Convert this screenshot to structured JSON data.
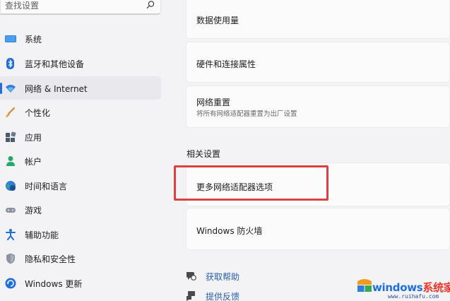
{
  "search": {
    "placeholder": "查找设置"
  },
  "sidebar": {
    "items": [
      {
        "label": "系统",
        "icon": "monitor-icon"
      },
      {
        "label": "蓝牙和其他设备",
        "icon": "bluetooth-icon"
      },
      {
        "label": "网络 & Internet",
        "icon": "wifi-icon",
        "active": true
      },
      {
        "label": "个性化",
        "icon": "brush-icon"
      },
      {
        "label": "应用",
        "icon": "apps-icon"
      },
      {
        "label": "帐户",
        "icon": "account-icon"
      },
      {
        "label": "时间和语言",
        "icon": "globe-clock-icon"
      },
      {
        "label": "游戏",
        "icon": "gamepad-icon"
      },
      {
        "label": "辅助功能",
        "icon": "accessibility-icon"
      },
      {
        "label": "隐私和安全性",
        "icon": "shield-icon"
      },
      {
        "label": "Windows 更新",
        "icon": "update-icon"
      }
    ]
  },
  "main": {
    "cards": [
      {
        "title": "数据使用量"
      },
      {
        "title": "硬件和连接属性"
      },
      {
        "title": "网络重置",
        "description": "将所有网络适配器重置为出厂设置"
      }
    ],
    "related_title": "相关设置",
    "related": [
      {
        "title": "更多网络适配器选项",
        "highlighted": true
      },
      {
        "title": "Windows 防火墙"
      }
    ],
    "links": [
      {
        "label": "获取帮助",
        "icon": "help-icon"
      },
      {
        "label": "提供反馈",
        "icon": "feedback-icon"
      }
    ]
  },
  "watermark": {
    "brand_a": "windows",
    "brand_b": "系统家园",
    "url": "www.ruihafu.com"
  },
  "colors": {
    "accent": "#1f6fd6",
    "highlight": "#d84242",
    "link": "#2a5fa8"
  }
}
